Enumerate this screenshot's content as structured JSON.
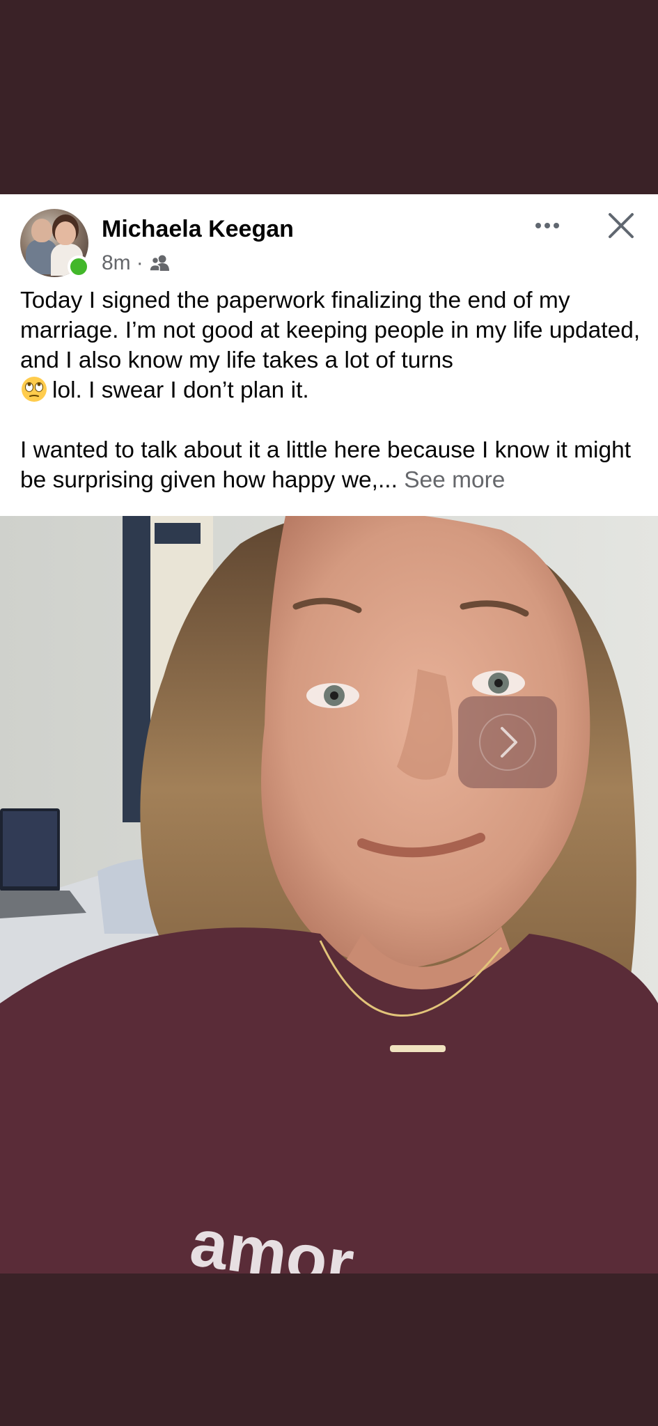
{
  "post": {
    "author_name": "Michaela Keegan",
    "timestamp": "8m",
    "separator": "·",
    "audience_icon": "friends-icon",
    "paragraph_1_before_emoji": "Today I signed the paperwork finalizing the end of my marriage. I’m not good at keeping people in my life updated, and I also know my life takes a lot of turns",
    "emoji": "face-with-rolling-eyes",
    "paragraph_1_after_emoji": "lol. I swear I don’t plan it.",
    "paragraph_2": "I wanted to talk about it a little here because I know it might be surprising given how happy we,...",
    "see_more_label": "See more",
    "photo_shirt_text": "amor",
    "online_status": "active",
    "colors": {
      "background": "#3a2227",
      "card": "#ffffff",
      "name": "#050505",
      "meta": "#65676b",
      "online": "#42b72a",
      "shirt": "#5a2c38"
    }
  },
  "controls": {
    "more_icon": "more-horizontal-icon",
    "close_icon": "close-icon",
    "next_icon": "chevron-right-icon"
  }
}
